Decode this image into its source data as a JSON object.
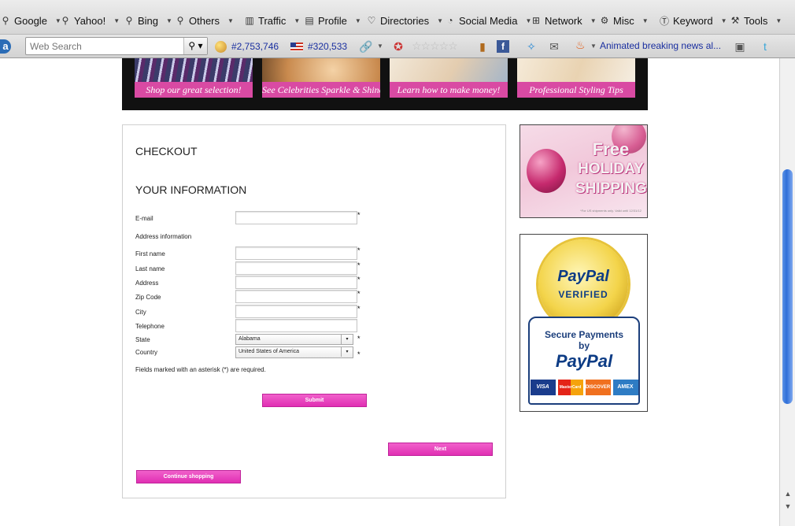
{
  "toolbar1": {
    "items": [
      {
        "label": "Google",
        "icon": "search-icon"
      },
      {
        "label": "Yahoo!",
        "icon": "search-icon"
      },
      {
        "label": "Bing",
        "icon": "search-icon"
      },
      {
        "label": "Others",
        "icon": "search-icon"
      },
      {
        "label": "Traffic",
        "icon": "bar-chart-icon"
      },
      {
        "label": "Profile",
        "icon": "profile-card-icon"
      },
      {
        "label": "Directories",
        "icon": "heart-icon"
      },
      {
        "label": "Social Media",
        "icon": "speech-bubble-icon"
      },
      {
        "label": "Network",
        "icon": "network-icon"
      },
      {
        "label": "Misc",
        "icon": "gear-icon"
      },
      {
        "label": "Keyword",
        "icon": "keyword-icon"
      },
      {
        "label": "Tools",
        "icon": "wrench-icon"
      }
    ]
  },
  "toolbar2": {
    "search_placeholder": "Web Search",
    "alexa_rank": "#2,753,746",
    "us_rank": "#320,533",
    "news_ticker": "Animated breaking news al..."
  },
  "banner": {
    "tiles": [
      {
        "caption": "Shop our great selection!"
      },
      {
        "caption": "See Celebrities Sparkle & Shine!"
      },
      {
        "caption": "Learn how to make money!"
      },
      {
        "caption": "Professional Styling Tips"
      }
    ]
  },
  "checkout": {
    "title": "CHECKOUT",
    "section_title": "YOUR INFORMATION",
    "fields": {
      "email": "E-mail",
      "address_info": "Address information",
      "first_name": "First name",
      "last_name": "Last name",
      "address": "Address",
      "zip": "Zip Code",
      "city": "City",
      "telephone": "Telephone",
      "state": "State",
      "country": "Country"
    },
    "state_value": "Alabama",
    "country_value": "United States of America",
    "asterisk": "*",
    "required_note": "Fields marked with an asterisk (*) are required.",
    "submit_label": "Submit",
    "next_label": "Next",
    "continue_label": "Continue shopping"
  },
  "ads": {
    "holiday": {
      "line1": "Free",
      "line2": "HOLIDAY",
      "line3": "SHIPPING",
      "fine_print": "*For US shipments only. Valid until 12/31/12"
    },
    "paypal": {
      "seal_line1": "PayPal",
      "seal_line2": "VERIFIED",
      "secure_line1": "Secure Payments",
      "secure_line2": "by",
      "brand": "PayPal",
      "cards": [
        "VISA",
        "MasterCard",
        "DISCOVER",
        "AMEX"
      ]
    }
  },
  "colors": {
    "accent_pink": "#e23bb6",
    "link_blue": "#1a2fa0"
  }
}
